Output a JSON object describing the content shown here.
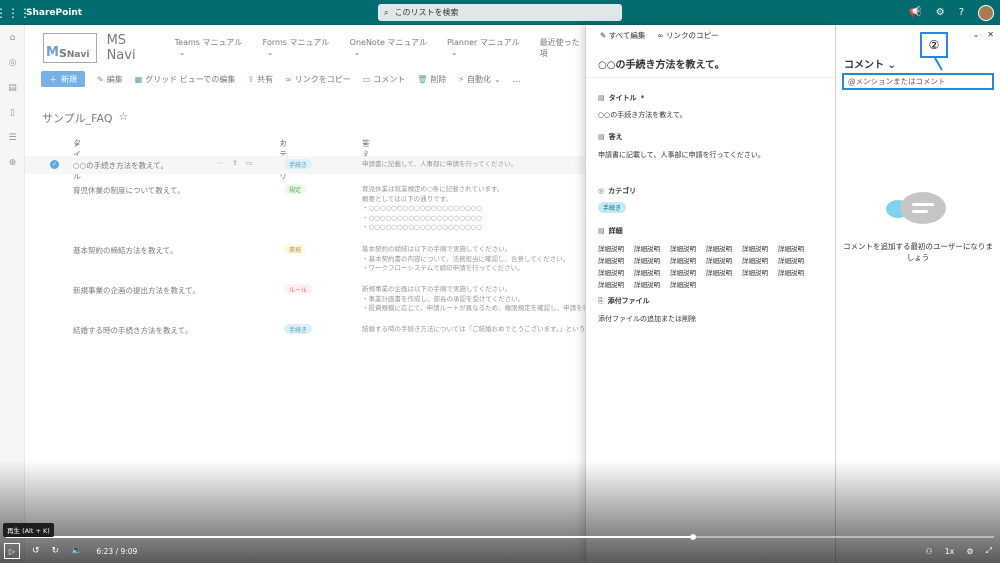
{
  "suitebar": {
    "app_name": "SharePoint",
    "search_placeholder": "このリストを検索",
    "icons": [
      "waffle-icon",
      "megaphone-icon",
      "gear-icon",
      "help-icon"
    ]
  },
  "site": {
    "logo_m": "M",
    "logo_s": "S",
    "logo_text": "Navi",
    "name": "MS Navi",
    "nav": [
      "Teams マニュアル",
      "Forms マニュアル",
      "OneNote マニュアル",
      "Planner マニュアル",
      "最近使った項"
    ]
  },
  "commandbar": {
    "new": "新規",
    "edit": "編集",
    "grid_edit": "グリッド ビューでの編集",
    "share": "共有",
    "copy_link": "リンクをコピー",
    "comment": "コメント",
    "delete": "削除",
    "automate": "自動化",
    "more": "…"
  },
  "list": {
    "title": "サンプル_FAQ",
    "columns": {
      "title": "タイトル",
      "category": "カテゴリ",
      "answer": "答え"
    },
    "rows": [
      {
        "title": "○○の手続き方法を教えて。",
        "category": "手続き",
        "cat_bg": "#c7e8f9",
        "cat_fg": "#036c70",
        "answer": "申請書に記載して、人事部に申請を行ってください。",
        "selected": true
      },
      {
        "title": "育児休業の制度について教えて。",
        "category": "規定",
        "cat_bg": "#dff6dd",
        "cat_fg": "#107c10",
        "answer": "育児休業は就業規定の○条に記載されています。\n概要としては以下の通りです。\n・○○○○○○○○○○○○○○○○○○○○\n・○○○○○○○○○○○○○○○○○○○○\n・○○○○○○○○○○○○○○○○○○○○"
      },
      {
        "title": "基本契約の締結方法を教えて。",
        "category": "業務",
        "cat_bg": "#fff4ce",
        "cat_fg": "#8a6d00",
        "answer": "基本契約の締結は以下の手順で実施してください。\n・基本契約書の内容について、法務担当に確認し、合意してください。\n・ワークフローシステムで締印申請を行ってください。"
      },
      {
        "title": "新規事業の企画の提出方法を教えて。",
        "category": "ルール",
        "cat_bg": "#fde7e9",
        "cat_fg": "#a4262c",
        "answer": "新規事業の企画は以下の手順で実施してください。\n・事業計画書を作成し、部長の承認を受けてください。\n・投資規模に応じて、申請ルートが異なるため、権限規定を確認し、申請を行って"
      },
      {
        "title": "結婚する時の手続き方法を教えて。",
        "category": "手続き",
        "cat_bg": "#c7e8f9",
        "cat_fg": "#036c70",
        "answer": "結婚する時の手続き方法については「ご結婚おめでとうございます。」というペ"
      }
    ]
  },
  "panel": {
    "edit_all": "すべて編集",
    "copy_link": "リンクのコピー",
    "item_title": "○○の手続き方法を教えて。",
    "title_label": "タイトル",
    "required_mark": "*",
    "title_value": "○○の手続き方法を教えて。",
    "answer_label": "答え",
    "answer_value": "申請書に記載して、人事部に申請を行ってください。",
    "category_label": "カテゴリ",
    "category_value": "手続き",
    "detail_label": "詳細",
    "detail_values": [
      "詳細説明",
      "詳細説明",
      "詳細説明",
      "詳細説明",
      "詳細説明",
      "詳細説明",
      "詳細説明",
      "詳細説明",
      "詳細説明",
      "詳細説明",
      "詳細説明",
      "詳細説明",
      "詳細説明",
      "詳細説明",
      "詳細説明",
      "詳細説明",
      "詳細説明",
      "詳細説明",
      "詳細説明",
      "詳細説明",
      "詳細説明"
    ],
    "attachment_label": "添付ファイル",
    "attachment_value": "添付ファイルの追加または削除"
  },
  "comments": {
    "title": "コメント",
    "input_placeholder": "@メンションまたはコメント",
    "empty_text": "コメントを追加する最初のユーザーになりましょう"
  },
  "annotation": {
    "label": "②"
  },
  "video": {
    "tooltip": "再生 (Alt + K)",
    "time": "6:23 / 9:09",
    "speed": "1x",
    "progress": 0.695
  }
}
